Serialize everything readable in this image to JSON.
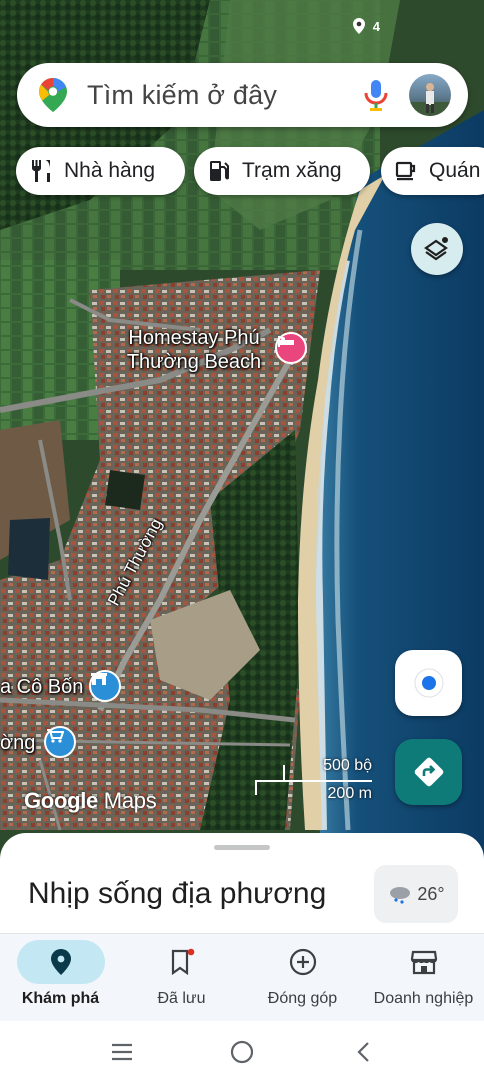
{
  "status": {
    "indicator": "4"
  },
  "search": {
    "placeholder": "Tìm kiếm ở đây"
  },
  "chips": [
    {
      "label": "Nhà hàng",
      "icon": "restaurant-icon"
    },
    {
      "label": "Trạm xăng",
      "icon": "gas-station-icon"
    },
    {
      "label": "Quán",
      "icon": "cafe-icon"
    }
  ],
  "map": {
    "poi_homestay": "Homestay Phú Thường Beach",
    "poi_shop": "a Cô Bốn",
    "poi_market": "ờng",
    "street_label": "Phú Thường",
    "scale_top": "500 bộ",
    "scale_bottom": "200 m",
    "logo_google": "Google",
    "logo_maps": "Maps"
  },
  "sheet": {
    "title": "Nhịp sống địa phương",
    "temperature": "26°"
  },
  "nav": {
    "explore": "Khám phá",
    "saved": "Đã lưu",
    "contribute": "Đóng góp",
    "business": "Doanh nghiệp"
  },
  "colors": {
    "accent": "#1a73e8",
    "directions": "#0e7b79",
    "explore_pill": "#c3e7f3",
    "poi_pink": "#e8467c",
    "poi_blue": "#2a8fd6"
  }
}
